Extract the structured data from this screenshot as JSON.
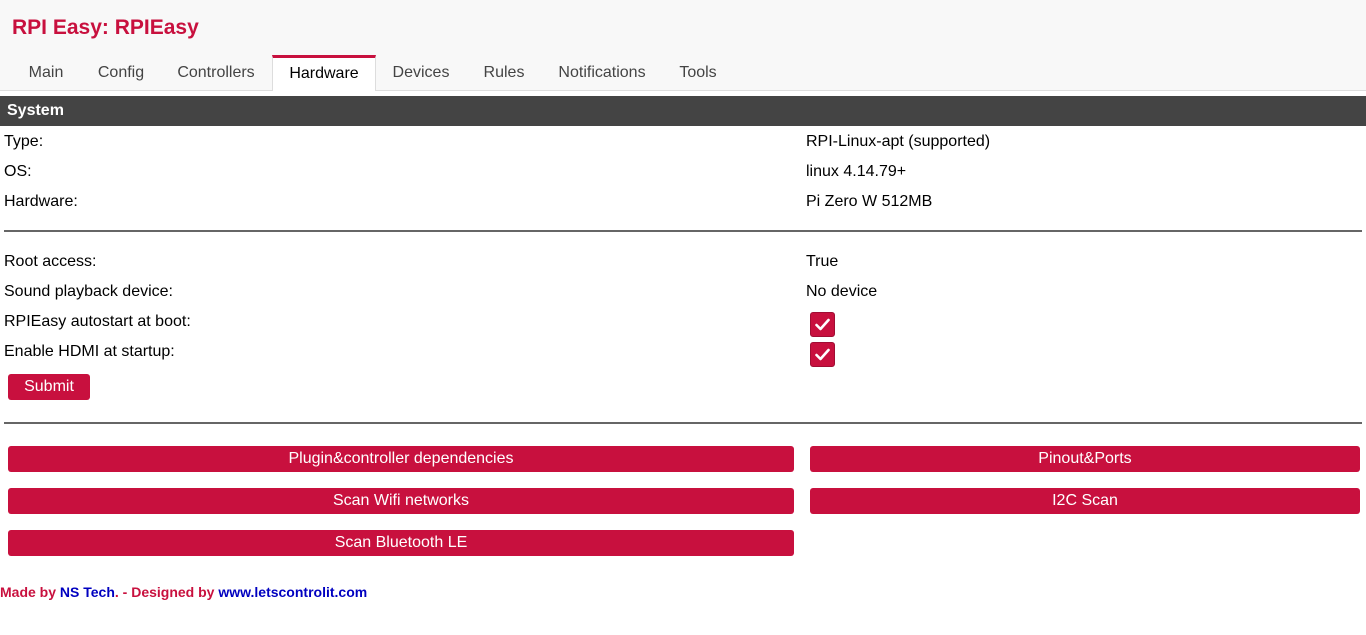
{
  "header": {
    "title": "RPI Easy: RPIEasy"
  },
  "tabs": [
    {
      "label": "Main"
    },
    {
      "label": "Config"
    },
    {
      "label": "Controllers"
    },
    {
      "label": "Hardware"
    },
    {
      "label": "Devices"
    },
    {
      "label": "Rules"
    },
    {
      "label": "Notifications"
    },
    {
      "label": "Tools"
    }
  ],
  "active_tab": "Hardware",
  "section": {
    "title": "System"
  },
  "info": [
    {
      "label": "Type:",
      "value": "RPI-Linux-apt (supported)"
    },
    {
      "label": "OS:",
      "value": "linux 4.14.79+"
    },
    {
      "label": "Hardware:",
      "value": "Pi Zero W 512MB"
    }
  ],
  "settings": [
    {
      "label": "Root access:",
      "value": "True"
    },
    {
      "label": "Sound playback device:",
      "value": "No device"
    },
    {
      "label": "RPIEasy autostart at boot:",
      "checked": true
    },
    {
      "label": "Enable HDMI at startup:",
      "checked": true
    }
  ],
  "submit_label": "Submit",
  "actions": [
    {
      "label": "Plugin&controller dependencies"
    },
    {
      "label": "Pinout&Ports"
    },
    {
      "label": "Scan Wifi networks"
    },
    {
      "label": "I2C Scan"
    },
    {
      "label": "Scan Bluetooth LE"
    }
  ],
  "footer": {
    "made_by": "Made by",
    "author": "NS Tech",
    "designed_by": ". - Designed by",
    "site": "www.letscontrolit.com"
  },
  "colors": {
    "accent": "#c8103e",
    "section_bg": "#444444",
    "link": "#0000c0"
  }
}
